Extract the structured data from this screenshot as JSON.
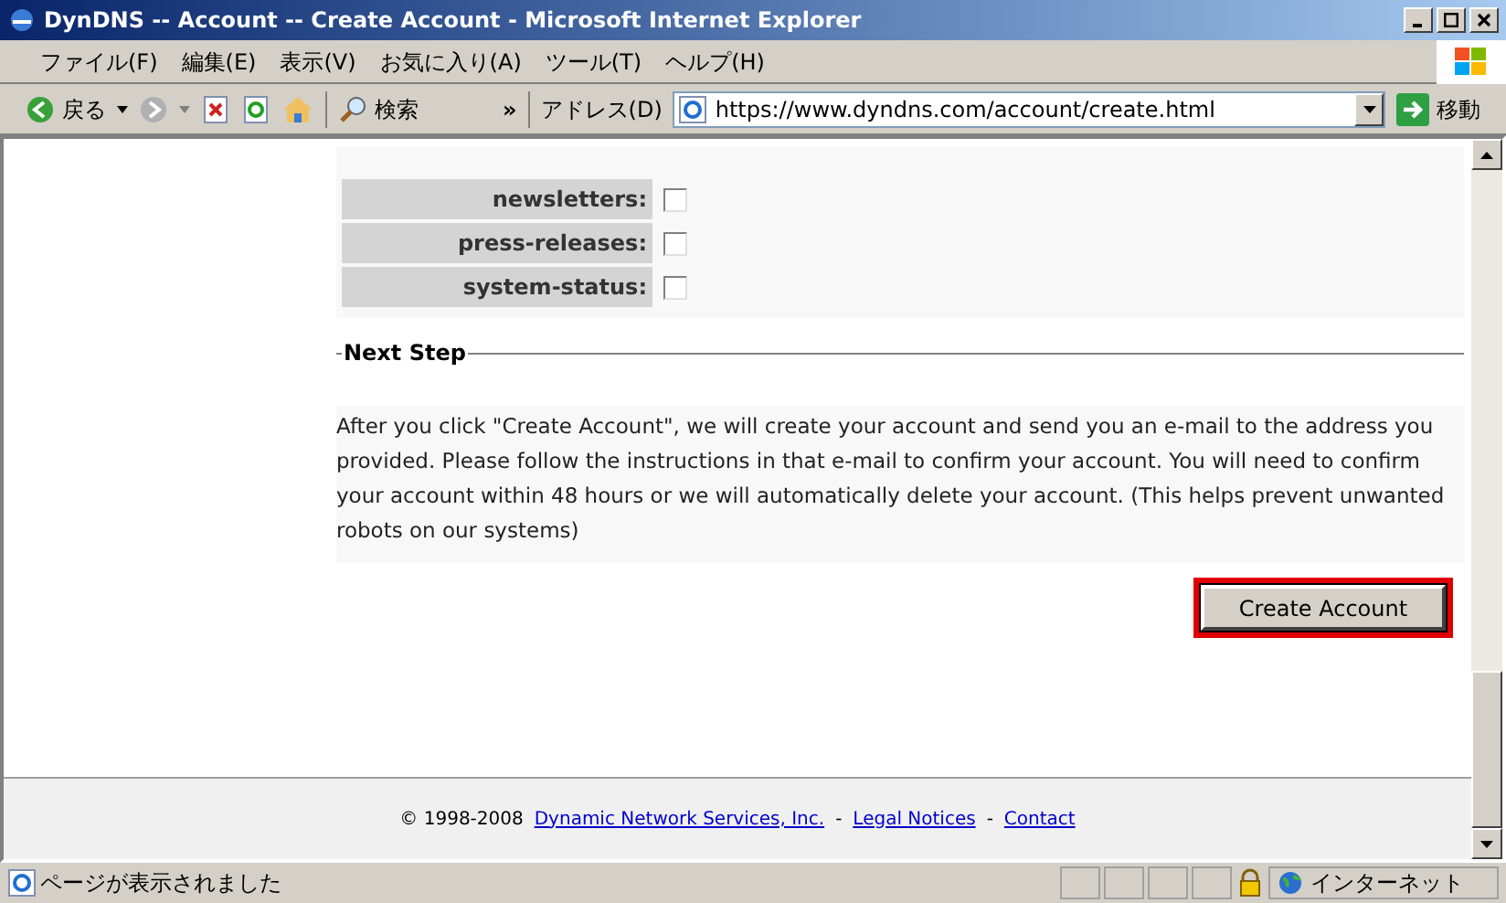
{
  "window": {
    "title": "DynDNS -- Account -- Create Account - Microsoft Internet Explorer"
  },
  "menu": [
    "ファイル(F)",
    "編集(E)",
    "表示(V)",
    "お気に入り(A)",
    "ツール(T)",
    "ヘルプ(H)"
  ],
  "toolbar": {
    "back": "戻る",
    "search": "検索",
    "more": "»",
    "address_label": "アドレス(D)",
    "url": "https://www.dyndns.com/account/create.html",
    "go": "移動"
  },
  "subscriptions": [
    {
      "label": "newsletters:",
      "checked": false
    },
    {
      "label": "press-releases:",
      "checked": false
    },
    {
      "label": "system-status:",
      "checked": false
    }
  ],
  "next_step": {
    "legend": "Next Step",
    "text": "After you click \"Create Account\", we will create your account and send you an e-mail to the address you provided. Please follow the instructions in that e-mail to confirm your account. You will need to confirm your account within 48 hours or we will automatically delete your account. (This helps prevent unwanted robots on our systems)"
  },
  "create_button": {
    "label": "Create Account"
  },
  "footer": {
    "copyright": "© 1998-2008",
    "separator": "-",
    "links": [
      "Dynamic Network Services, Inc.",
      "Legal Notices",
      "Contact"
    ]
  },
  "status_bar": {
    "text": "ページが表示されました",
    "zone": "インターネット"
  }
}
